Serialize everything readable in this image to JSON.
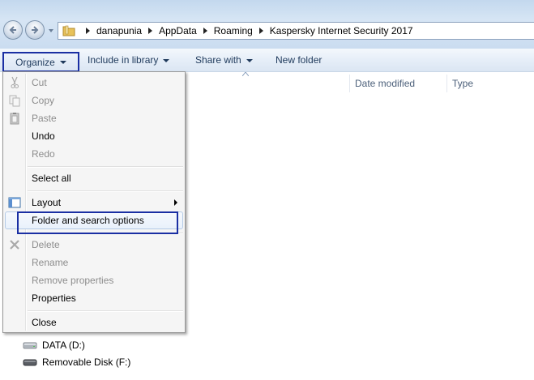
{
  "address": {
    "crumbs": [
      "danapunia",
      "AppData",
      "Roaming",
      "Kaspersky Internet Security 2017"
    ]
  },
  "toolbar": {
    "organize": "Organize",
    "include_in_library": "Include in library",
    "share_with": "Share with",
    "new_folder": "New folder"
  },
  "columns": {
    "date_modified": "Date modified",
    "type": "Type"
  },
  "nav_pane": {
    "drives": [
      {
        "label": "DATA (D:)",
        "icon": "hard-drive-icon"
      },
      {
        "label": "Removable Disk (F:)",
        "icon": "removable-disk-icon"
      }
    ]
  },
  "menu": {
    "items": [
      {
        "label": "Cut",
        "enabled": false,
        "icon": "cut-icon"
      },
      {
        "label": "Copy",
        "enabled": false,
        "icon": "copy-icon"
      },
      {
        "label": "Paste",
        "enabled": false,
        "icon": "paste-icon"
      },
      {
        "label": "Undo",
        "enabled": true
      },
      {
        "label": "Redo",
        "enabled": false
      },
      {
        "label": "Select all",
        "enabled": true
      },
      {
        "label": "Layout",
        "enabled": true,
        "icon": "layout-icon",
        "submenu": true
      },
      {
        "label": "Folder and search options",
        "enabled": true,
        "highlighted": true
      },
      {
        "label": "Delete",
        "enabled": false,
        "icon": "delete-icon"
      },
      {
        "label": "Rename",
        "enabled": false
      },
      {
        "label": "Remove properties",
        "enabled": false
      },
      {
        "label": "Properties",
        "enabled": true
      },
      {
        "label": "Close",
        "enabled": true
      }
    ]
  },
  "colors": {
    "annotation_outline": "#1a2fa3",
    "menu_background": "#f5f5f5",
    "disabled_text": "#8d8d8d"
  }
}
